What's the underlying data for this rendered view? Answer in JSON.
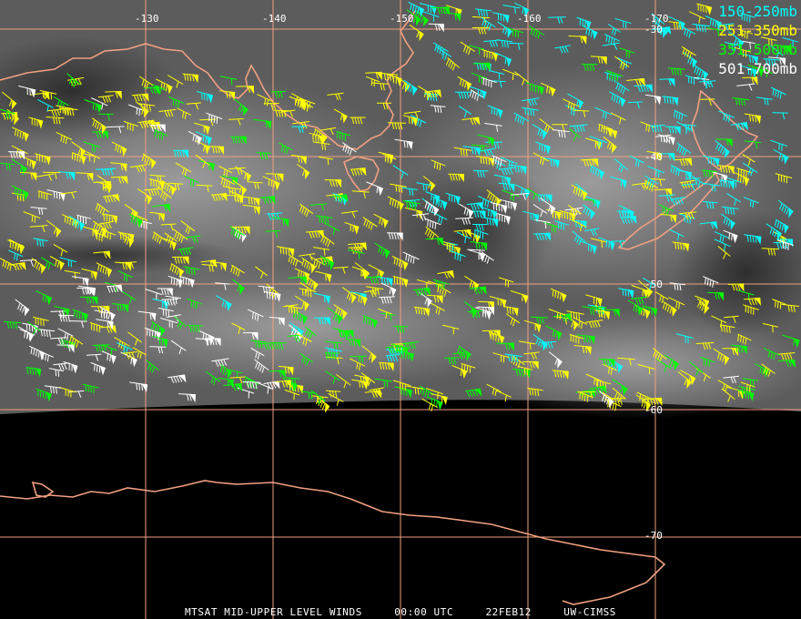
{
  "map": {
    "lon_labels": [
      "-130",
      "-140",
      "-150",
      "-160",
      "-170"
    ],
    "lat_labels": [
      "-30",
      "-40",
      "-50",
      "-60",
      "-70"
    ],
    "grid_color": "#f0a080",
    "coast_color": "#f0a080"
  },
  "legend": [
    {
      "label": "150-250mb",
      "color": "#00ffff"
    },
    {
      "label": "251-350mb",
      "color": "#ffff00"
    },
    {
      "label": "351-500mb",
      "color": "#00ff00"
    },
    {
      "label": "501-700mb",
      "color": "#ffffff"
    }
  ],
  "footer": {
    "product": "MTSAT MID-UPPER LEVEL WINDS",
    "time": "00:00 UTC",
    "date": "22FEB12",
    "source": "UW-CIMSS"
  }
}
